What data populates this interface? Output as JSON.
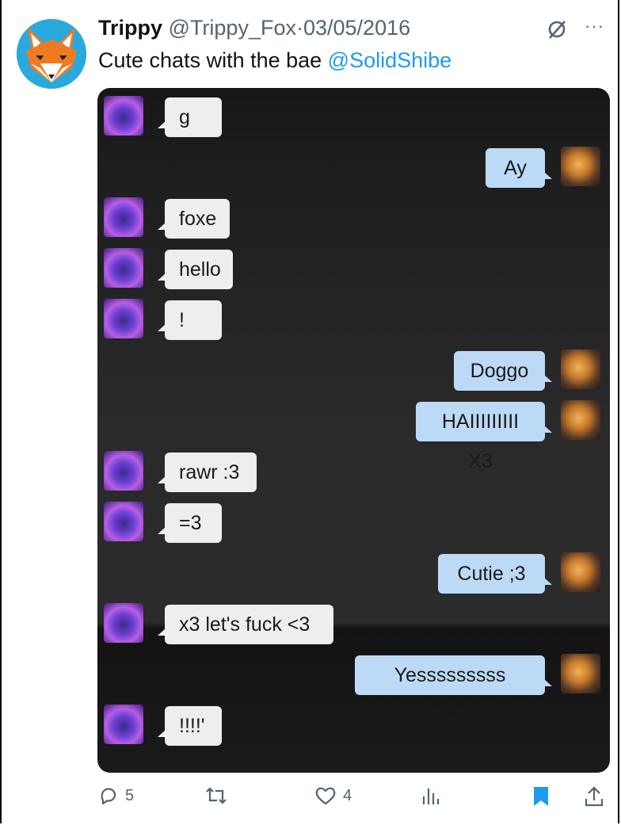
{
  "tweet": {
    "display_name": "Trippy",
    "handle": "@Trippy_Fox",
    "separator": "·",
    "date": "03/05/2016",
    "text": "Cute chats with the bae ",
    "mention": "@SolidShibe",
    "more_icon": "···"
  },
  "chat": {
    "messages": [
      {
        "side": "left",
        "text": "g"
      },
      {
        "side": "right",
        "text": "Ay"
      },
      {
        "side": "left",
        "text": "foxe"
      },
      {
        "side": "left",
        "text": "hello"
      },
      {
        "side": "left",
        "text": "!"
      },
      {
        "side": "right",
        "text": "Doggo"
      },
      {
        "side": "right",
        "text": "HAIIIIIIIII X3"
      },
      {
        "side": "left",
        "text": "rawr :3"
      },
      {
        "side": "left",
        "text": "=3"
      },
      {
        "side": "right",
        "text": "Cutie ;3"
      },
      {
        "side": "left",
        "text": "x3 let's fuck <3"
      },
      {
        "side": "right",
        "text": "Yesssssssss <333"
      },
      {
        "side": "left",
        "text": "!!!!'"
      }
    ]
  },
  "actions": {
    "replies": "5",
    "likes": "4",
    "bookmark_color": "#1d9bf0"
  },
  "colors": {
    "accent": "#1d9bf0",
    "muted": "#536471",
    "incoming_bubble": "#eeeeee",
    "outgoing_bubble": "#bcd9f5"
  }
}
